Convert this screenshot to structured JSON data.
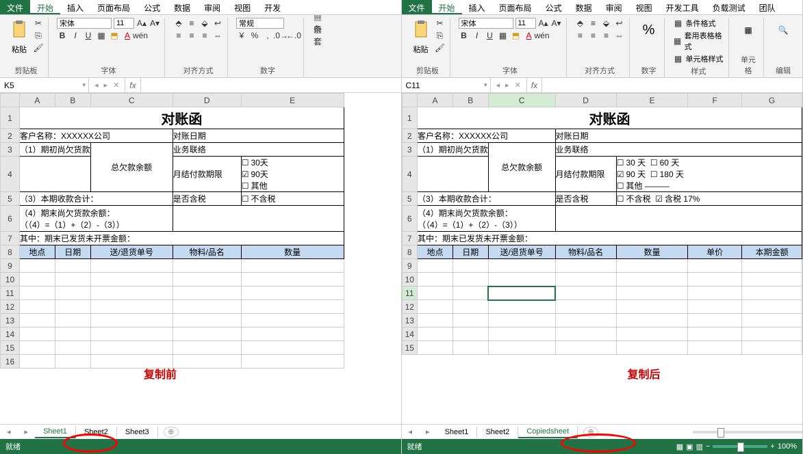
{
  "left": {
    "tabs": {
      "file": "文件",
      "home": "开始",
      "insert": "插入",
      "layout": "页面布局",
      "formula": "公式",
      "data": "数据",
      "review": "审阅",
      "view": "视图",
      "dev": "开发"
    },
    "ribbon": {
      "clipboard": "剪贴板",
      "paste": "粘贴",
      "font": "字体",
      "fontName": "宋体",
      "fontSize": "11",
      "align": "对齐方式",
      "number": "数字",
      "numFormat": "常规"
    },
    "nameBox": "K5",
    "fx": "fx",
    "cols": [
      "A",
      "B",
      "C",
      "D",
      "E"
    ],
    "doc": {
      "title": "对账函",
      "custLabel": "客户名称：XXXXXX公司",
      "dateLabel": "对账日期",
      "r3a": "（1）期初尚欠货款",
      "r3b": "业务联络",
      "balance": "总欠款余额",
      "payterm": "月结付款期限",
      "ck30": "30天",
      "ck90": "90天",
      "ckOther": "其他",
      "r5a": "（3）本期收款合计：",
      "taxQ": "是否含税",
      "noTax": "不含税",
      "r6": "（4）期末尚欠货款余额：\n（（4）=（1）+（2）-（3））",
      "r7": "其中：期末已发货未开票金额：",
      "h1": "地点",
      "h2": "日期",
      "h3": "送/退货单号",
      "h4": "物料/品名",
      "h5": "数量"
    },
    "annot": "复制前",
    "sheets": [
      "Sheet1",
      "Sheet2",
      "Sheet3"
    ],
    "status": "就绪"
  },
  "right": {
    "tabs": {
      "file": "文件",
      "home": "开始",
      "insert": "插入",
      "layout": "页面布局",
      "formula": "公式",
      "data": "数据",
      "review": "审阅",
      "view": "视图",
      "dev": "开发工具",
      "load": "负载测试",
      "team": "团队"
    },
    "ribbon": {
      "clipboard": "剪贴板",
      "paste": "粘贴",
      "font": "字体",
      "fontName": "宋体",
      "fontSize": "11",
      "align": "对齐方式",
      "number": "数字",
      "styles": "样式",
      "cond": "条件格式",
      "tblFmt": "套用表格格式",
      "cellStyle": "单元格样式",
      "cells": "单元格",
      "edit": "编辑"
    },
    "nameBox": "C11",
    "fx": "fx",
    "cols": [
      "A",
      "B",
      "C",
      "D",
      "E",
      "F",
      "G"
    ],
    "doc": {
      "title": "对账函",
      "custLabel": "客户名称：XXXXXX公司",
      "dateLabel": "对账日期",
      "r3a": "（1）期初尚欠货款",
      "r3b": "业务联络",
      "balance": "总欠款余额",
      "payterm": "月结付款期限",
      "ck30": "30 天",
      "ck60": "60 天",
      "ck90": "90 天",
      "ck180": "180 天",
      "ckOther": "其他 ———",
      "r5a": "（3）本期收款合计：",
      "taxQ": "是否含税",
      "noTax": "不含税",
      "withTax": "含税 17%",
      "r6": "（4）期末尚欠货款余额：\n（（4）=（1）+（2）-（3））",
      "r7": "其中：期末已发货未开票金额：",
      "h1": "地点",
      "h2": "日期",
      "h3": "送/退货单号",
      "h4": "物料/品名",
      "h5": "数量",
      "h6": "单价",
      "h7": "本期金额"
    },
    "annot": "复制后",
    "sheets": [
      "Sheet1",
      "Sheet2",
      "Copiedsheet"
    ],
    "status": "就绪",
    "zoom": "100%"
  }
}
